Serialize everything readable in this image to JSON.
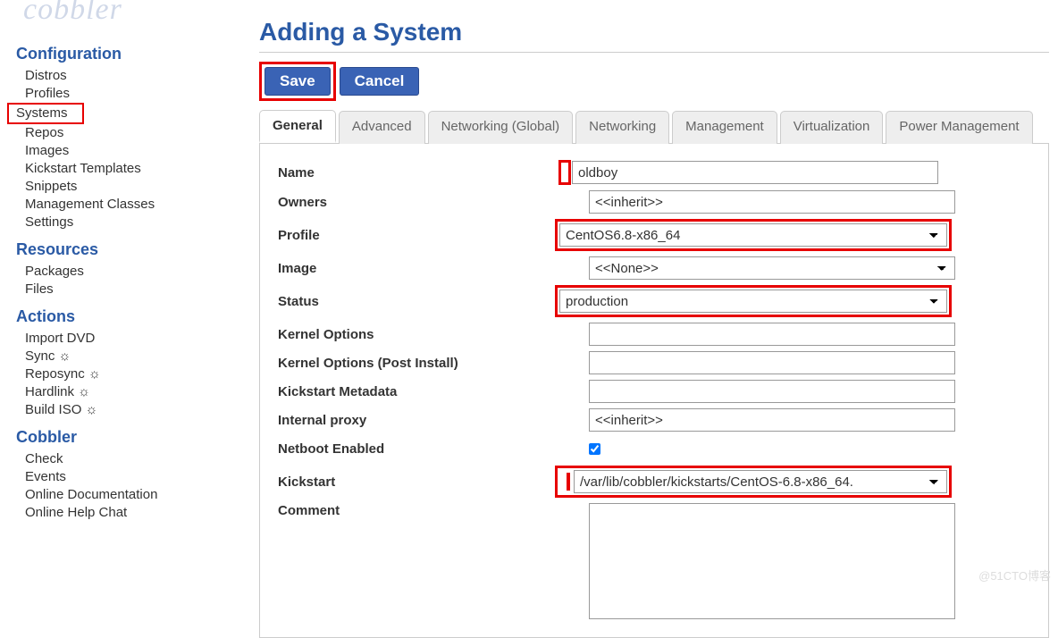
{
  "logo": "cobbler",
  "sidebar": {
    "sections": [
      {
        "title": "Configuration",
        "items": [
          {
            "label": "Distros"
          },
          {
            "label": "Profiles"
          },
          {
            "label": "Systems",
            "highlighted": true
          },
          {
            "label": "Repos"
          },
          {
            "label": "Images"
          },
          {
            "label": "Kickstart Templates"
          },
          {
            "label": "Snippets"
          },
          {
            "label": "Management Classes"
          },
          {
            "label": "Settings"
          }
        ]
      },
      {
        "title": "Resources",
        "items": [
          {
            "label": "Packages"
          },
          {
            "label": "Files"
          }
        ]
      },
      {
        "title": "Actions",
        "items": [
          {
            "label": "Import DVD"
          },
          {
            "label": "Sync ☼"
          },
          {
            "label": "Reposync ☼"
          },
          {
            "label": "Hardlink ☼"
          },
          {
            "label": "Build ISO ☼"
          }
        ]
      },
      {
        "title": "Cobbler",
        "items": [
          {
            "label": "Check"
          },
          {
            "label": "Events"
          },
          {
            "label": "Online Documentation"
          },
          {
            "label": "Online Help Chat"
          }
        ]
      }
    ]
  },
  "page": {
    "title": "Adding a System",
    "save_label": "Save",
    "cancel_label": "Cancel"
  },
  "tabs": [
    {
      "label": "General",
      "active": true
    },
    {
      "label": "Advanced"
    },
    {
      "label": "Networking (Global)"
    },
    {
      "label": "Networking"
    },
    {
      "label": "Management"
    },
    {
      "label": "Virtualization"
    },
    {
      "label": "Power Management"
    }
  ],
  "form": {
    "name": {
      "label": "Name",
      "value": "oldboy"
    },
    "owners": {
      "label": "Owners",
      "value": "<<inherit>>"
    },
    "profile": {
      "label": "Profile",
      "value": "CentOS6.8-x86_64"
    },
    "image": {
      "label": "Image",
      "value": "<<None>>"
    },
    "status": {
      "label": "Status",
      "value": "production"
    },
    "kernel_options": {
      "label": "Kernel Options",
      "value": ""
    },
    "kernel_options_post": {
      "label": "Kernel Options (Post Install)",
      "value": ""
    },
    "kickstart_metadata": {
      "label": "Kickstart Metadata",
      "value": ""
    },
    "internal_proxy": {
      "label": "Internal proxy",
      "value": "<<inherit>>"
    },
    "netboot_enabled": {
      "label": "Netboot Enabled",
      "checked": true
    },
    "kickstart": {
      "label": "Kickstart",
      "value": "/var/lib/cobbler/kickstarts/CentOS-6.8-x86_64."
    },
    "comment": {
      "label": "Comment",
      "value": ""
    }
  },
  "watermark": "@51CTO博客"
}
